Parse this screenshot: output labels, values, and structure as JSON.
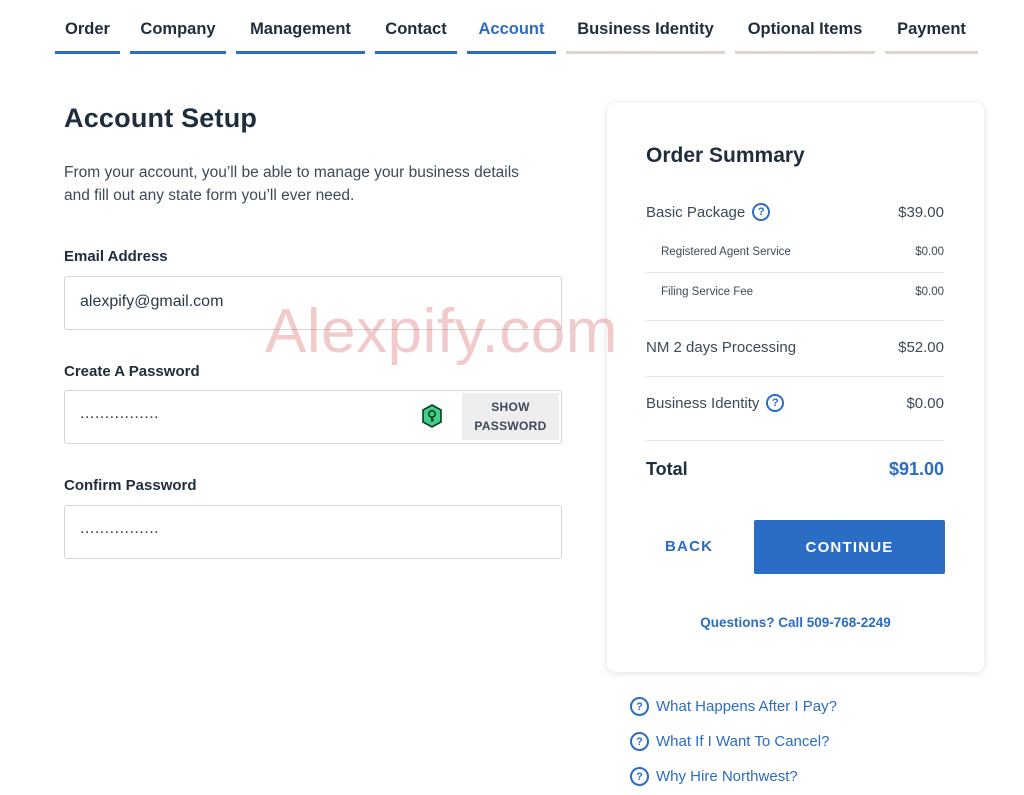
{
  "tabs": [
    {
      "label": "Order",
      "state": "done"
    },
    {
      "label": "Company",
      "state": "done"
    },
    {
      "label": "Management",
      "state": "done"
    },
    {
      "label": "Contact",
      "state": "done"
    },
    {
      "label": "Account",
      "state": "active"
    },
    {
      "label": "Business Identity",
      "state": "pending"
    },
    {
      "label": "Optional Items",
      "state": "pending"
    },
    {
      "label": "Payment",
      "state": "pending"
    }
  ],
  "form": {
    "title": "Account Setup",
    "intro": "From your account, you’ll be able to manage your business details and fill out any state form you’ll ever need.",
    "email_label": "Email Address",
    "email_value": "alexpify@gmail.com",
    "password_label": "Create A Password",
    "password_value": "................",
    "show_password_line1": "SHOW",
    "show_password_line2": "PASSWORD",
    "confirm_label": "Confirm Password",
    "confirm_value": "................"
  },
  "summary": {
    "title": "Order Summary",
    "basic_package_label": "Basic Package",
    "basic_package_value": "$39.00",
    "registered_agent_label": "Registered Agent Service",
    "registered_agent_value": "$0.00",
    "filing_fee_label": "Filing Service Fee",
    "filing_fee_value": "$0.00",
    "processing_label": "NM 2 days Processing",
    "processing_value": "$52.00",
    "business_identity_label": "Business Identity",
    "business_identity_value": "$0.00",
    "total_label": "Total",
    "total_value": "$91.00",
    "back_label": "BACK",
    "continue_label": "CONTINUE",
    "phone_text": "Questions? Call 509-768-2249"
  },
  "faq": [
    "What Happens After I Pay?",
    "What If I Want To Cancel?",
    "Why Hire Northwest?"
  ],
  "watermark": "Alexpify.com",
  "colors": {
    "accent": "#2b6cc4",
    "inactive_tab": "#dcd6cf",
    "text_dark": "#1f2d3d"
  }
}
